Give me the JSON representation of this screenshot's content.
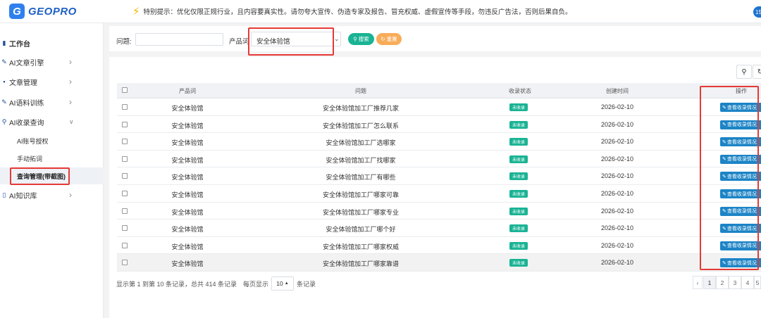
{
  "header": {
    "logo_letter": "G",
    "logo_text": "GEOPRO",
    "notice": "特别提示：优化仅限正规行业，且内容要真实性。请勿夸大宣传、伪造专家及报告、冒充权威、虚假宣传等手段，勿违反广告法，否则后果自负。",
    "avatar_text": "15"
  },
  "sidebar": {
    "items": [
      {
        "label": "工作台"
      },
      {
        "label": "AI文章引擎"
      },
      {
        "label": "文章管理"
      },
      {
        "label": "AI语料训练"
      },
      {
        "label": "AI收录查询"
      },
      {
        "label": "AI知识库"
      }
    ],
    "sub_items": [
      {
        "label": "AI账号授权"
      },
      {
        "label": "手动拓词"
      },
      {
        "label": "查询管理(带截图)"
      }
    ]
  },
  "search": {
    "question_label": "问题:",
    "question_value": "",
    "product_label": "产品词",
    "product_value": "安全体验馆",
    "search_label": "搜索",
    "reset_label": "重置"
  },
  "table": {
    "headers": [
      "产品词",
      "问题",
      "收录状态",
      "创建时间",
      "操作"
    ],
    "rows": [
      {
        "product": "安全体验馆",
        "question": "安全体验馆加工厂推荐几家",
        "status": "未收录",
        "date": "2026-02-10",
        "action": "查看收录情况"
      },
      {
        "product": "安全体验馆",
        "question": "安全体验馆加工厂怎么联系",
        "status": "未收录",
        "date": "2026-02-10",
        "action": "查看收录情况"
      },
      {
        "product": "安全体验馆",
        "question": "安全体验馆加工厂选哪家",
        "status": "未收录",
        "date": "2026-02-10",
        "action": "查看收录情况"
      },
      {
        "product": "安全体验馆",
        "question": "安全体验馆加工厂找哪家",
        "status": "未收录",
        "date": "2026-02-10",
        "action": "查看收录情况"
      },
      {
        "product": "安全体验馆",
        "question": "安全体验馆加工厂有哪些",
        "status": "未收录",
        "date": "2026-02-10",
        "action": "查看收录情况"
      },
      {
        "product": "安全体验馆",
        "question": "安全体验馆加工厂哪家可靠",
        "status": "未收录",
        "date": "2026-02-10",
        "action": "查看收录情况"
      },
      {
        "product": "安全体验馆",
        "question": "安全体验馆加工厂哪家专业",
        "status": "未收录",
        "date": "2026-02-10",
        "action": "查看收录情况"
      },
      {
        "product": "安全体验馆",
        "question": "安全体验馆加工厂哪个好",
        "status": "未收录",
        "date": "2026-02-10",
        "action": "查看收录情况"
      },
      {
        "product": "安全体验馆",
        "question": "安全体验馆加工厂哪家权威",
        "status": "未收录",
        "date": "2026-02-10",
        "action": "查看收录情况"
      },
      {
        "product": "安全体验馆",
        "question": "安全体验馆加工厂哪家靠谱",
        "status": "未收录",
        "date": "2026-02-10",
        "action": "查看收录情况"
      }
    ]
  },
  "footer": {
    "summary": "显示第 1 到第 10 条记录，总共 414 条记录",
    "per_page_label": "每页显示",
    "page_size": "10",
    "records_label": "条记录",
    "pages": [
      "‹",
      "1",
      "2",
      "3",
      "4",
      "5"
    ]
  },
  "colors": {
    "success": "#1ab394",
    "primary": "#1c84c6",
    "warning": "#f8ac59",
    "highlight": "#e53935"
  }
}
